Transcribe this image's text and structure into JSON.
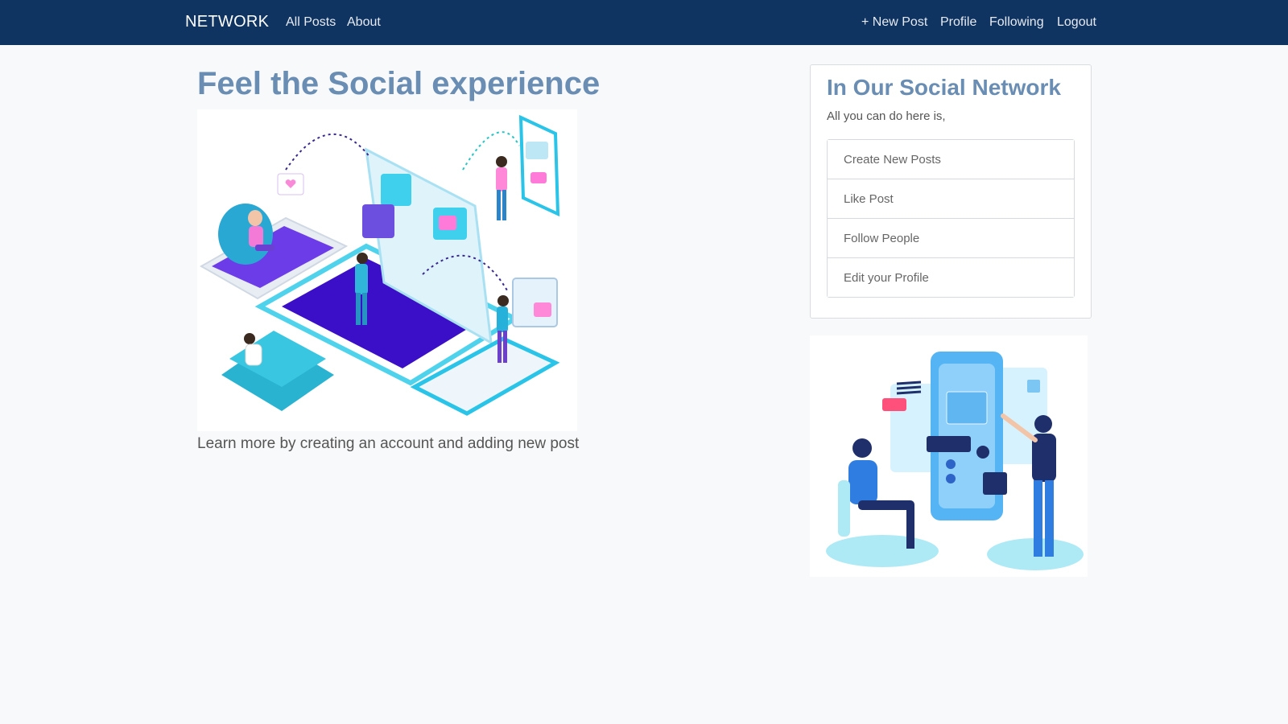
{
  "navbar": {
    "brand": "NETWORK",
    "left_links": [
      "All Posts",
      "About"
    ],
    "right_links": [
      "+ New Post",
      "Profile",
      "Following",
      "Logout"
    ]
  },
  "hero": {
    "title": "Feel the Social experience",
    "caption": "Learn more by creating an account and adding new post",
    "illustration": "isometric-social-network-illustration"
  },
  "card": {
    "title": "In Our Social Network",
    "subtitle": "All you can do here is,",
    "items": [
      "Create New Posts",
      "Like Post",
      "Follow People",
      "Edit your Profile"
    ]
  },
  "side": {
    "illustration": "people-using-phone-app-illustration"
  },
  "colors": {
    "navbar": "#0f3462",
    "heading": "#6a8db3",
    "page_background": "#f8f9fa"
  }
}
